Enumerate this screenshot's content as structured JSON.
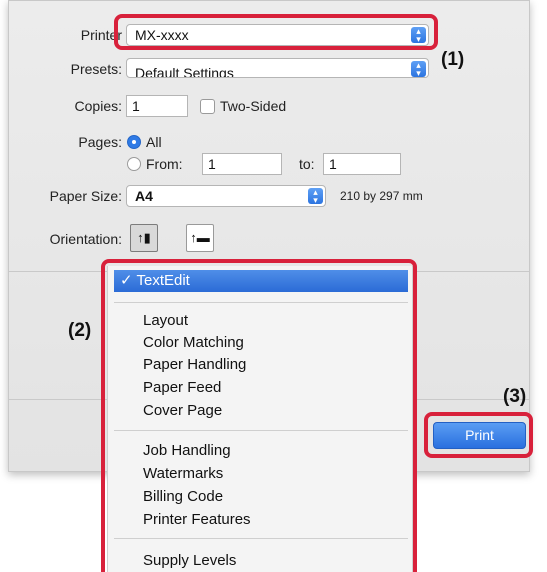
{
  "printer": {
    "label": "Printer",
    "value": "MX-xxxx"
  },
  "presets": {
    "label": "Presets:",
    "value": "Default Settings"
  },
  "copies": {
    "label": "Copies:",
    "value": "1",
    "two_sided_label": "Two-Sided",
    "two_sided_checked": false
  },
  "pages": {
    "label": "Pages:",
    "all_label": "All",
    "from_label": "From:",
    "from_value": "1",
    "to_label": "to:",
    "to_value": "1",
    "selected": "All"
  },
  "paper_size": {
    "label": "Paper Size:",
    "value": "A4",
    "dimensions": "210 by 297 mm"
  },
  "orientation": {
    "label": "Orientation:",
    "selected": "portrait"
  },
  "panel_menu": {
    "selected": "TextEdit",
    "check": "✓",
    "group1": [
      "Layout",
      "Color Matching",
      "Paper Handling",
      "Paper Feed",
      "Cover Page"
    ],
    "group2": [
      "Job Handling",
      "Watermarks",
      "Billing Code",
      "Printer Features"
    ],
    "group3": [
      "Supply Levels"
    ]
  },
  "print_button": {
    "label": "Print"
  },
  "callouts": {
    "c1": "(1)",
    "c2": "(2)",
    "c3": "(3)"
  },
  "colors": {
    "callout": "#d8213b",
    "accent": "#2f7ae5"
  }
}
